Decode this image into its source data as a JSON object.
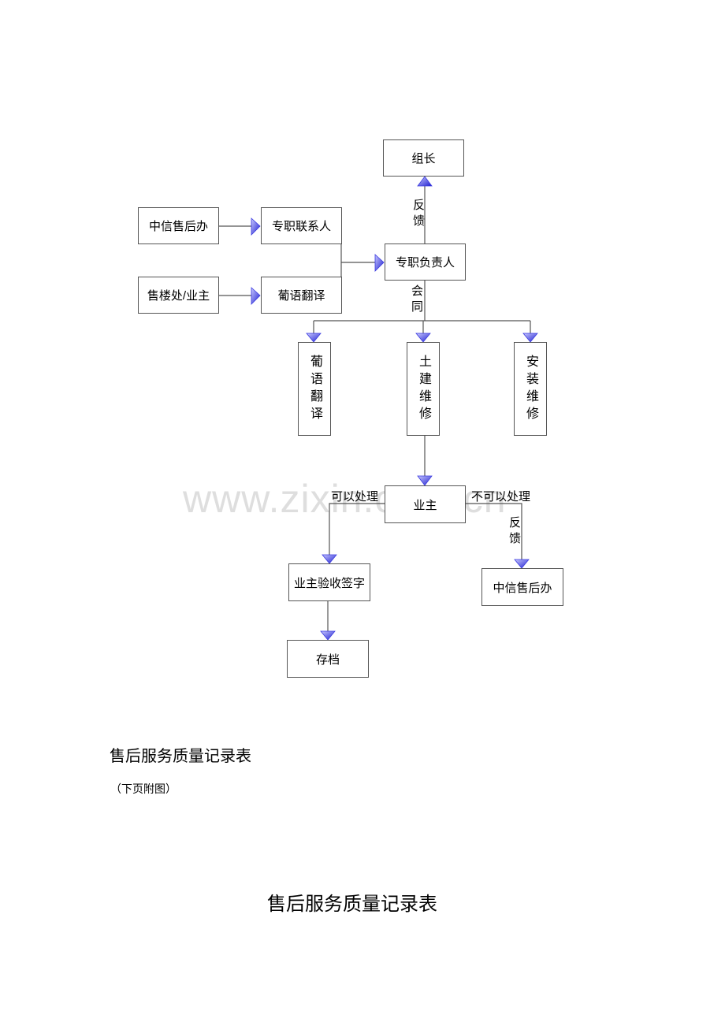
{
  "diagram": {
    "nodes": {
      "leader": "组长",
      "citic_office_top": "中信售后办",
      "liaison": "专职联系人",
      "sales_owner": "售楼处/业主",
      "translator_top": "葡语翻译",
      "responsible": "专职负责人",
      "translator": "葡语翻译",
      "civil_repair": "土建维修",
      "install_repair": "安装维修",
      "owner": "业主",
      "owner_sign": "业主验收签字",
      "citic_office_bottom": "中信售后办",
      "archive": "存档"
    },
    "edge_labels": {
      "feedback_top": "反馈",
      "together": "会同",
      "can_handle": "可以处理",
      "cannot_handle": "不可以处理",
      "feedback_bottom": "反馈"
    },
    "arrow_color": "#3a3ae0",
    "line_color": "#555555"
  },
  "watermark": "www.zixin.com.cn",
  "document": {
    "section_heading": "售后服务质量记录表",
    "note": "（下页附图）",
    "title": "售后服务质量记录表"
  }
}
